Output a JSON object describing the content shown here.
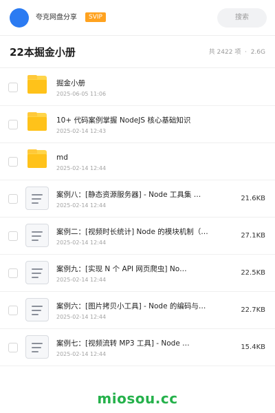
{
  "header": {
    "user_name": "夸克网盘分享",
    "badge": "SVIP",
    "search_label": "搜索"
  },
  "folder": {
    "title": "22本掘金小册",
    "count_text": "共 2422 项",
    "size_text": "2.6G",
    "separator": "·"
  },
  "files": [
    {
      "type": "folder",
      "name": "掘金小册",
      "date": "2025-06-05 11:06",
      "size": ""
    },
    {
      "type": "folder",
      "name": "10+ 代码案例掌握 NodeJS 核心基础知识",
      "date": "2025-02-14 12:43",
      "size": ""
    },
    {
      "type": "folder",
      "name": "md",
      "date": "2025-02-14 12:44",
      "size": ""
    },
    {
      "type": "doc",
      "name": "案例八：[静态资源服务器] - Node 工具集 …",
      "date": "2025-02-14 12:44",
      "size": "21.6KB"
    },
    {
      "type": "doc",
      "name": "案例二：[视频时长统计] Node 的模块机制（…",
      "date": "2025-02-14 12:44",
      "size": "27.1KB"
    },
    {
      "type": "doc",
      "name": "案例九：[实现 N 个 API 网页爬虫] No…",
      "date": "2025-02-14 12:44",
      "size": "22.5KB"
    },
    {
      "type": "doc",
      "name": "案例六：[图片拷贝小工具] - Node 的编码与…",
      "date": "2025-02-14 12:44",
      "size": "22.7KB"
    },
    {
      "type": "doc",
      "name": "案例七：[视频流转 MP3 工具] - Node …",
      "date": "2025-02-14 12:44",
      "size": "15.4KB"
    }
  ],
  "watermark": "miosou.cc",
  "colors": {
    "accent": "#2b7bf2",
    "badge": "#ffa21f",
    "folder": "#ffc21a",
    "watermark": "#25b14b"
  }
}
